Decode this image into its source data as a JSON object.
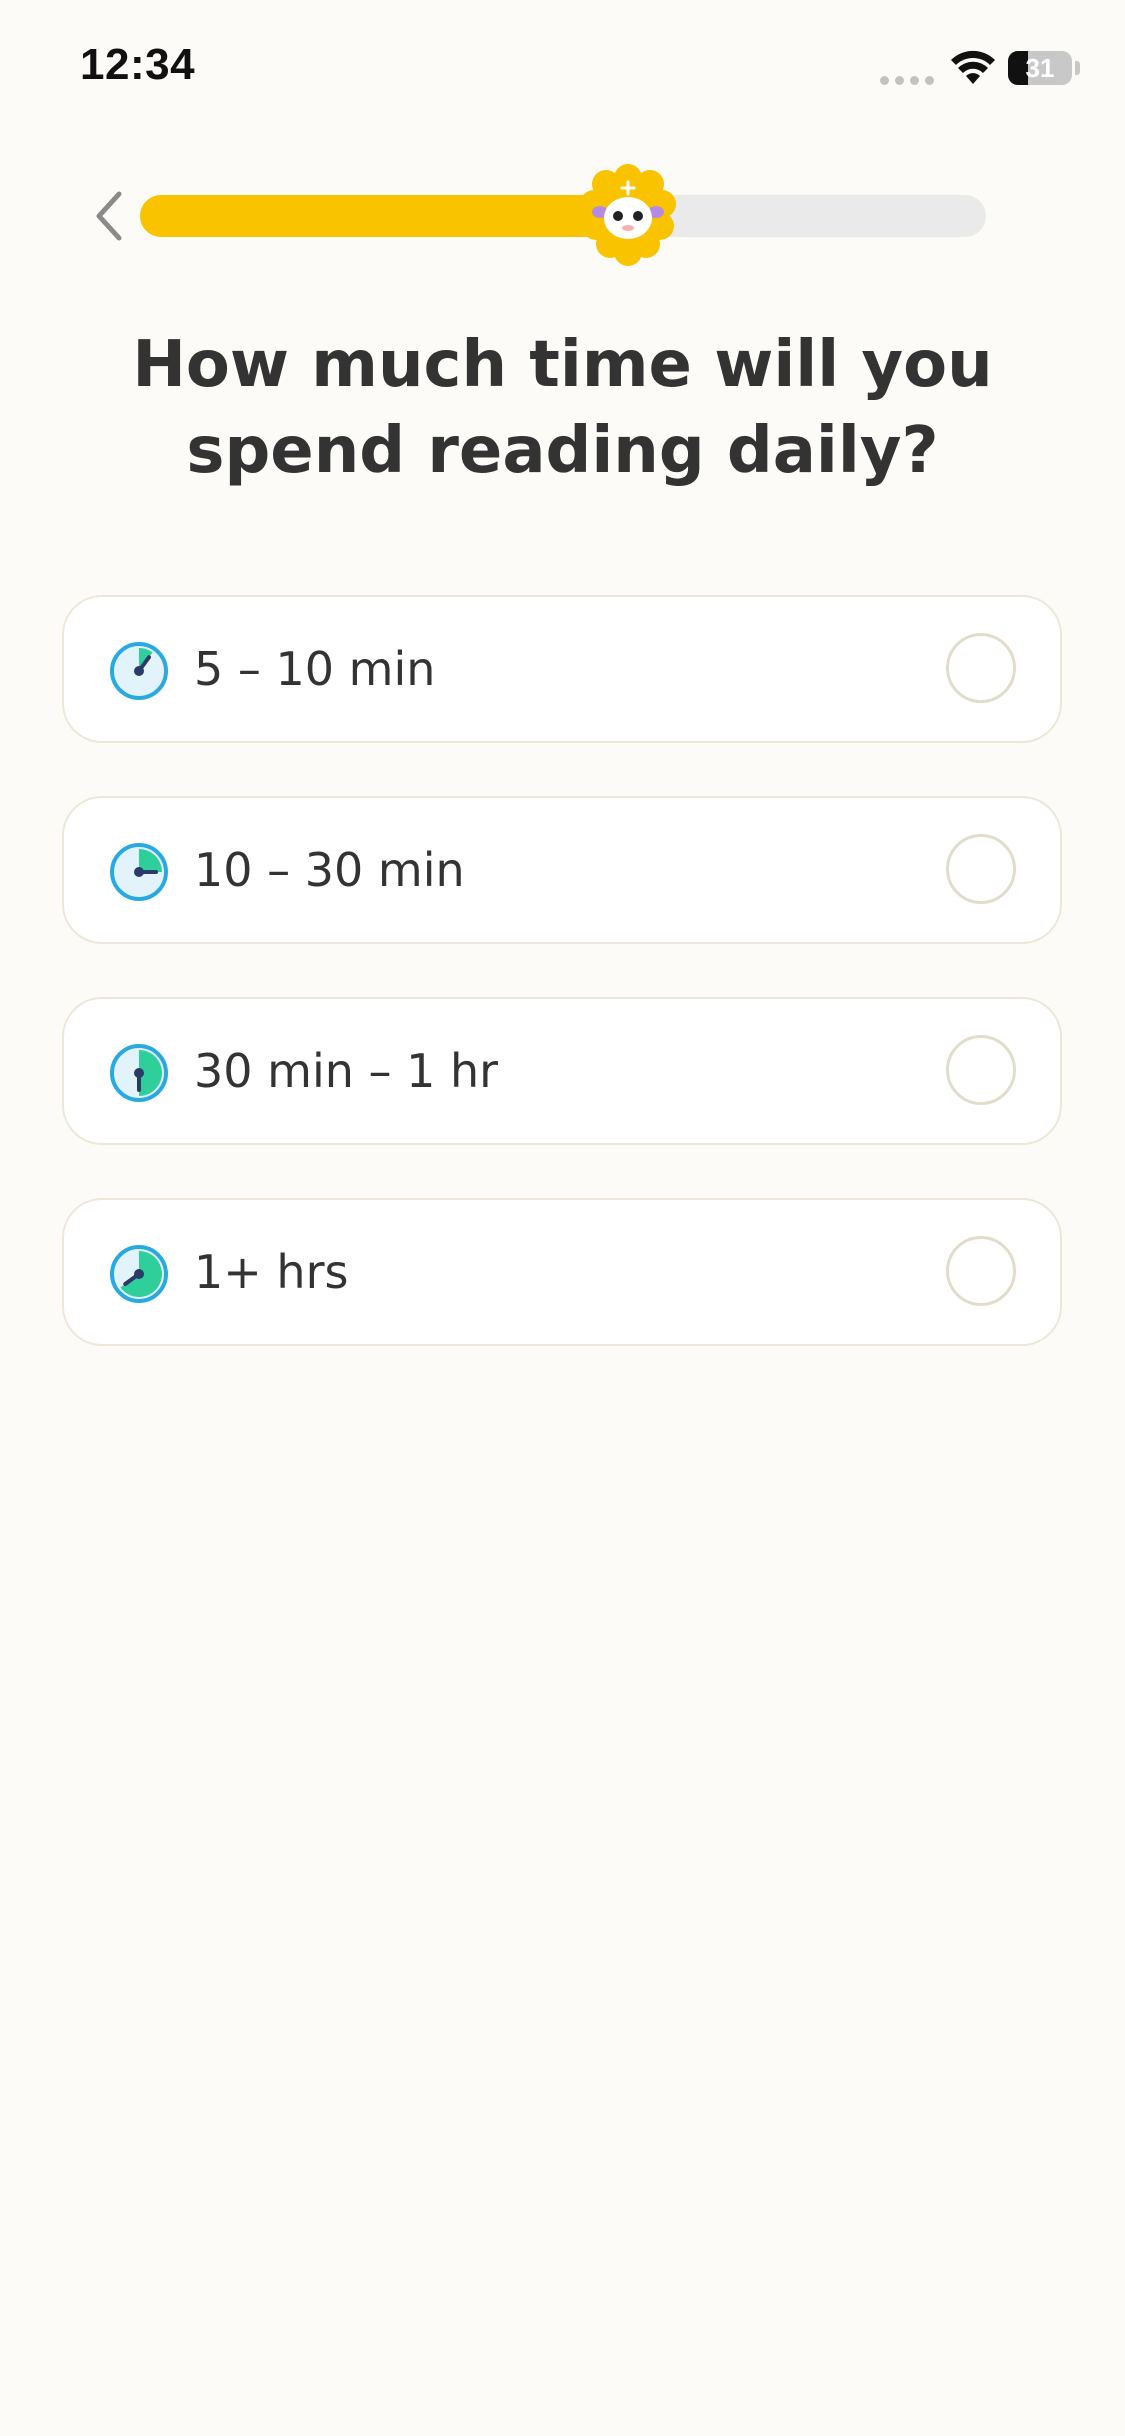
{
  "status_bar": {
    "time": "12:34",
    "battery_level": "31",
    "battery_fraction": 0.31
  },
  "header": {
    "back_icon": "chevron-left-icon",
    "progress_fraction": 0.6,
    "mascot_icon": "sheep-mascot-icon",
    "colors": {
      "progress_fill": "#f9c300",
      "progress_track": "#ebeaea",
      "mascot": "#f9c300"
    }
  },
  "question": {
    "title": "How much time will you\nspend reading daily?"
  },
  "options": [
    {
      "label": "5 – 10 min",
      "icon": "timer-icon",
      "timer_fraction": 0.1,
      "selected": false
    },
    {
      "label": "10 – 30 min",
      "icon": "timer-icon",
      "timer_fraction": 0.25,
      "selected": false
    },
    {
      "label": "30 min – 1 hr",
      "icon": "timer-icon",
      "timer_fraction": 0.5,
      "selected": false
    },
    {
      "label": "1+ hrs",
      "icon": "timer-icon",
      "timer_fraction": 0.65,
      "selected": false
    }
  ],
  "colors": {
    "background": "#fcfbf7",
    "timer_ring": "#2aa9e0",
    "timer_face": "#e3f3fb",
    "timer_fill": "#2ecf9a",
    "timer_hand": "#2b3a67",
    "radio_border": "#e2dccb"
  }
}
